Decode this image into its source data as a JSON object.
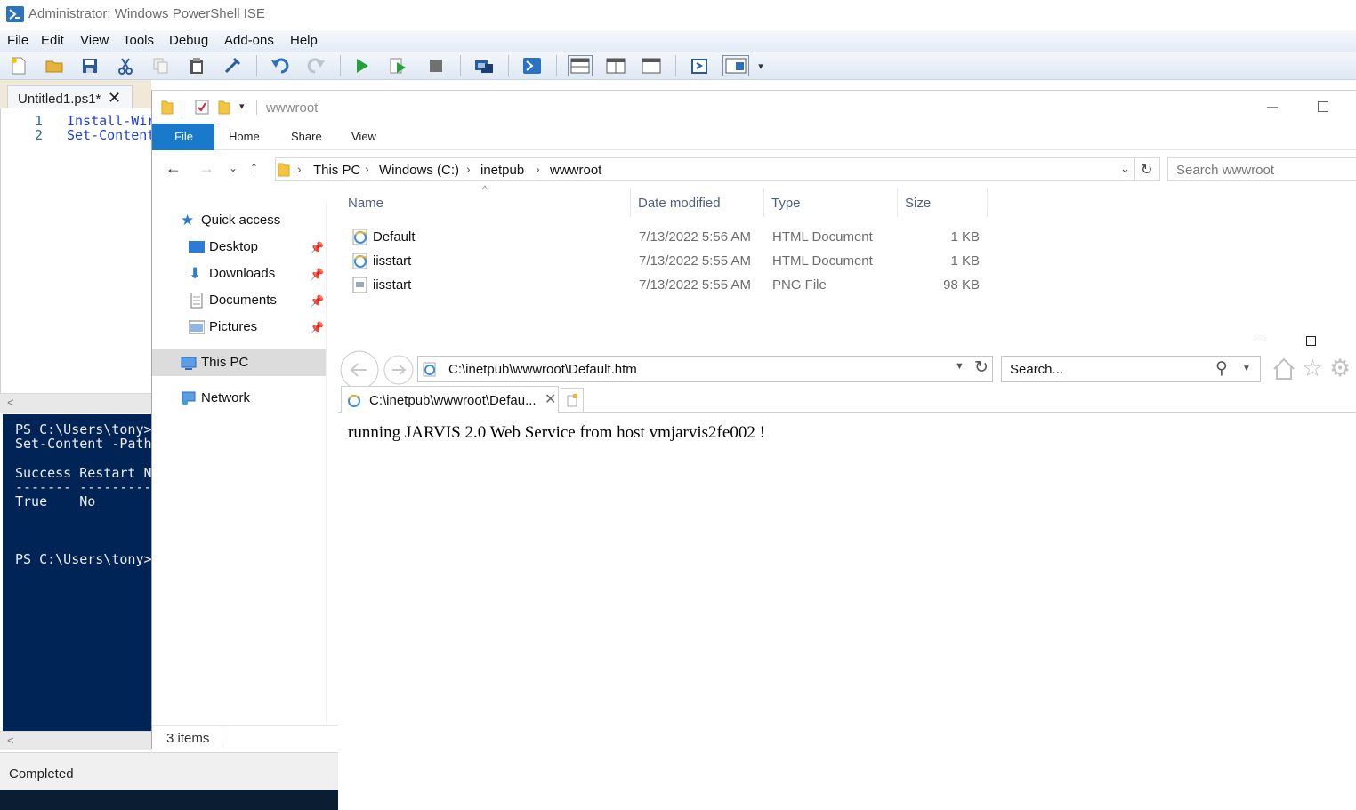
{
  "ise": {
    "title": "Administrator: Windows PowerShell ISE",
    "menu": [
      "File",
      "Edit",
      "View",
      "Tools",
      "Debug",
      "Add-ons",
      "Help"
    ],
    "tab_label": "Untitled1.ps1*",
    "tab_close": "✕",
    "editor_lines": [
      {
        "num": "1",
        "code": "Install-Wir"
      },
      {
        "num": "2",
        "code": "Set-Content"
      }
    ],
    "console_lines": [
      "PS C:\\Users\\tony>",
      "Set-Content -Path",
      "",
      "Success Restart N",
      "------- ---------",
      "True    No",
      "",
      "",
      "",
      "PS C:\\Users\\tony>"
    ],
    "status": "Completed"
  },
  "explorer": {
    "title": "wwwroot",
    "ribbon_tabs": [
      "File",
      "Home",
      "Share",
      "View"
    ],
    "breadcrumb": [
      "This PC",
      "Windows (C:)",
      "inetpub",
      "wwwroot"
    ],
    "search_placeholder": "Search wwwroot",
    "nav": {
      "quick_access": "Quick access",
      "desktop": "Desktop",
      "downloads": "Downloads",
      "documents": "Documents",
      "pictures": "Pictures",
      "this_pc": "This PC",
      "network": "Network"
    },
    "columns": [
      "Name",
      "Date modified",
      "Type",
      "Size"
    ],
    "files": [
      {
        "name": "Default",
        "date": "7/13/2022 5:56 AM",
        "type": "HTML Document",
        "size": "1 KB",
        "icon": "ie-document-icon"
      },
      {
        "name": "iisstart",
        "date": "7/13/2022 5:55 AM",
        "type": "HTML Document",
        "size": "1 KB",
        "icon": "ie-document-icon"
      },
      {
        "name": "iisstart",
        "date": "7/13/2022 5:55 AM",
        "type": "PNG File",
        "size": "98 KB",
        "icon": "image-file-icon"
      }
    ],
    "status": "3 items"
  },
  "ie": {
    "address": "C:\\inetpub\\wwwroot\\Default.htm",
    "search_placeholder": "Search...",
    "tab_title": "C:\\inetpub\\wwwroot\\Defau...",
    "content": "running JARVIS 2.0 Web Service from host vmjarvis2fe002 !"
  },
  "colors": {
    "ps_console_bg": "#012456",
    "ribbon_file_blue": "#1979ca",
    "code_blue": "#1e3cdc"
  }
}
